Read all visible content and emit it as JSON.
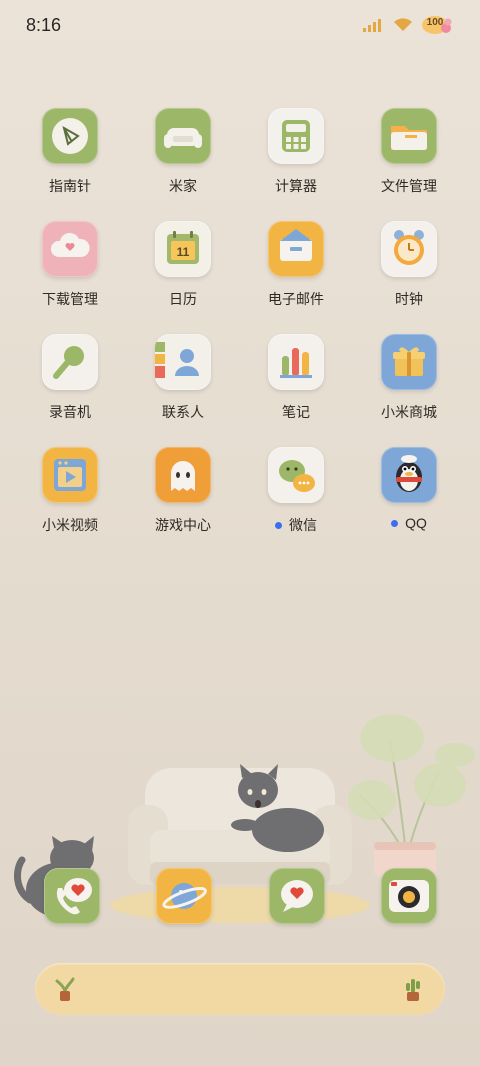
{
  "status_bar": {
    "time": "8:16",
    "battery": "100"
  },
  "apps": [
    {
      "label": "指南针",
      "icon": "compass-icon"
    },
    {
      "label": "米家",
      "icon": "sofa-icon"
    },
    {
      "label": "计算器",
      "icon": "calculator-icon"
    },
    {
      "label": "文件管理",
      "icon": "folder-icon"
    },
    {
      "label": "下载管理",
      "icon": "cloud-download-icon"
    },
    {
      "label": "日历",
      "icon": "calendar-icon",
      "badge": "11"
    },
    {
      "label": "电子邮件",
      "icon": "envelope-icon"
    },
    {
      "label": "时钟",
      "icon": "alarm-clock-icon"
    },
    {
      "label": "录音机",
      "icon": "microphone-icon"
    },
    {
      "label": "联系人",
      "icon": "contact-person-icon"
    },
    {
      "label": "笔记",
      "icon": "notes-bars-icon"
    },
    {
      "label": "小米商城",
      "icon": "gift-box-icon"
    },
    {
      "label": "小米视频",
      "icon": "video-player-icon"
    },
    {
      "label": "游戏中心",
      "icon": "ghost-icon"
    },
    {
      "label": "微信",
      "icon": "wechat-icon",
      "notification_dot": true
    },
    {
      "label": "QQ",
      "icon": "penguin-icon",
      "notification_dot": true
    }
  ],
  "dock": [
    {
      "icon": "phone-heart-icon"
    },
    {
      "icon": "planet-browser-icon"
    },
    {
      "icon": "message-heart-icon"
    },
    {
      "icon": "camera-icon"
    }
  ],
  "colors": {
    "background": "#e8e0d5",
    "search_bar": "#f2d9a3",
    "notification_dot": "#3b6ff0",
    "green_fur": "#9db56a",
    "orange_fur": "#f0b040",
    "blue_fur": "#7ea7d8"
  }
}
